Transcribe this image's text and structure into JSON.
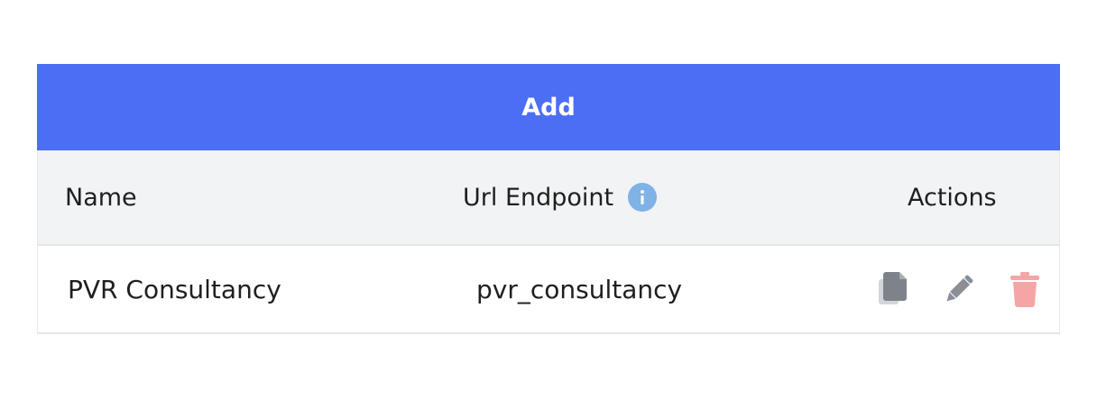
{
  "toolbar": {
    "add_label": "Add"
  },
  "table": {
    "columns": {
      "name": "Name",
      "url_endpoint": "Url Endpoint",
      "actions": "Actions"
    },
    "rows": [
      {
        "name": "PVR Consultancy",
        "url_endpoint": "pvr_consultancy"
      }
    ]
  },
  "icons": {
    "info": "info-icon",
    "copy": "copy-icon",
    "edit": "pencil-icon",
    "delete": "trash-icon"
  },
  "colors": {
    "accent": "#4c6ef5",
    "header_bg": "#f2f3f5",
    "info": "#7fb2e5",
    "delete": "#f6a5a5",
    "icon_gray": "#8a8f96"
  }
}
